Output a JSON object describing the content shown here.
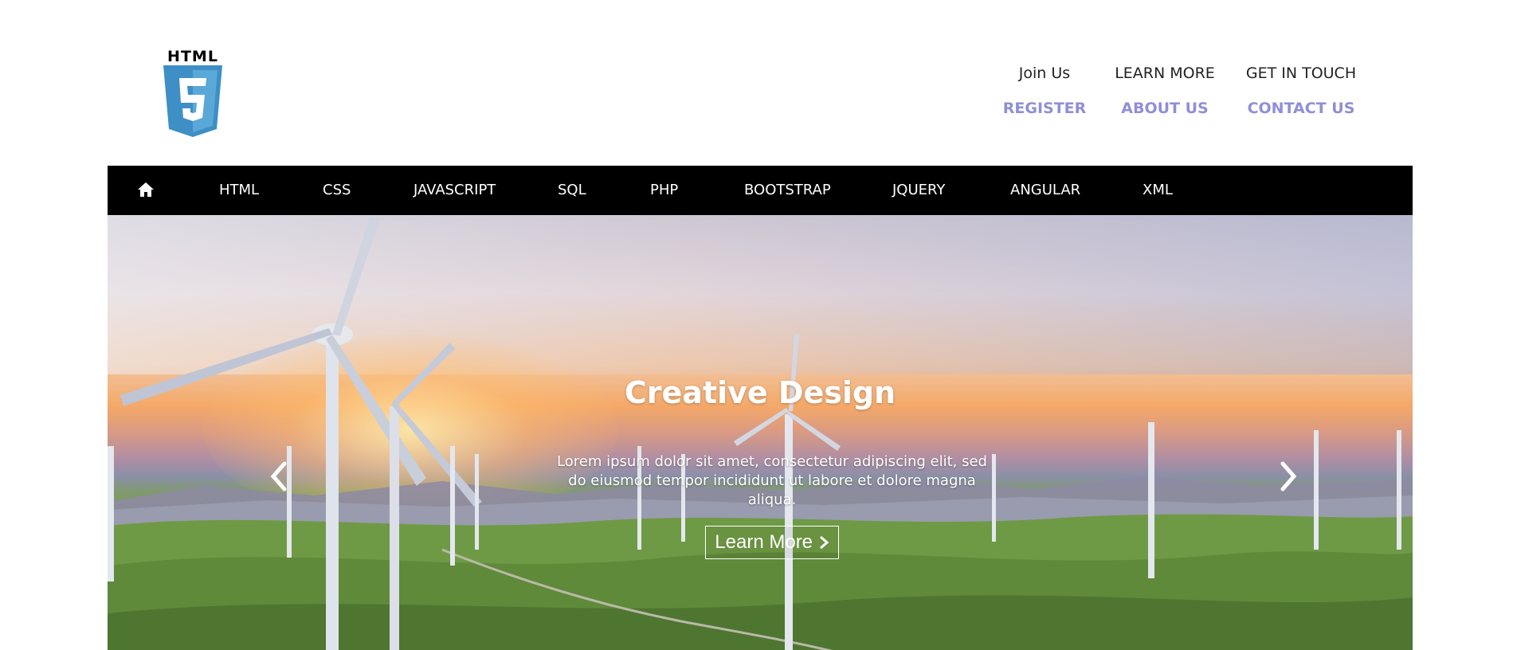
{
  "logo": {
    "text": "HTML",
    "icon": "html5-shield-icon",
    "brand_color": "#3d8fc6"
  },
  "top_links": [
    {
      "sub": "Join Us",
      "main": "REGISTER"
    },
    {
      "sub": "LEARN MORE",
      "main": "ABOUT US"
    },
    {
      "sub": "GET IN TOUCH",
      "main": "CONTACT US"
    }
  ],
  "nav": {
    "home_icon": "home-icon",
    "items": [
      "HTML",
      "CSS",
      "JAVASCRIPT",
      "SQL",
      "PHP",
      "BOOTSTRAP",
      "JQUERY",
      "ANGULAR",
      "XML"
    ]
  },
  "hero": {
    "title": "Creative Design",
    "description": "Lorem ipsum dolor sit amet, consectetur adipiscing elit, sed do eiusmod tempor incididunt ut labore et dolore magna aliqua.",
    "button_label": "Learn More",
    "prev_icon": "chevron-left-icon",
    "next_icon": "chevron-right-icon"
  },
  "colors": {
    "link_accent": "#8f8fd6",
    "nav_bg": "#000000",
    "nav_text": "#ffffff"
  }
}
